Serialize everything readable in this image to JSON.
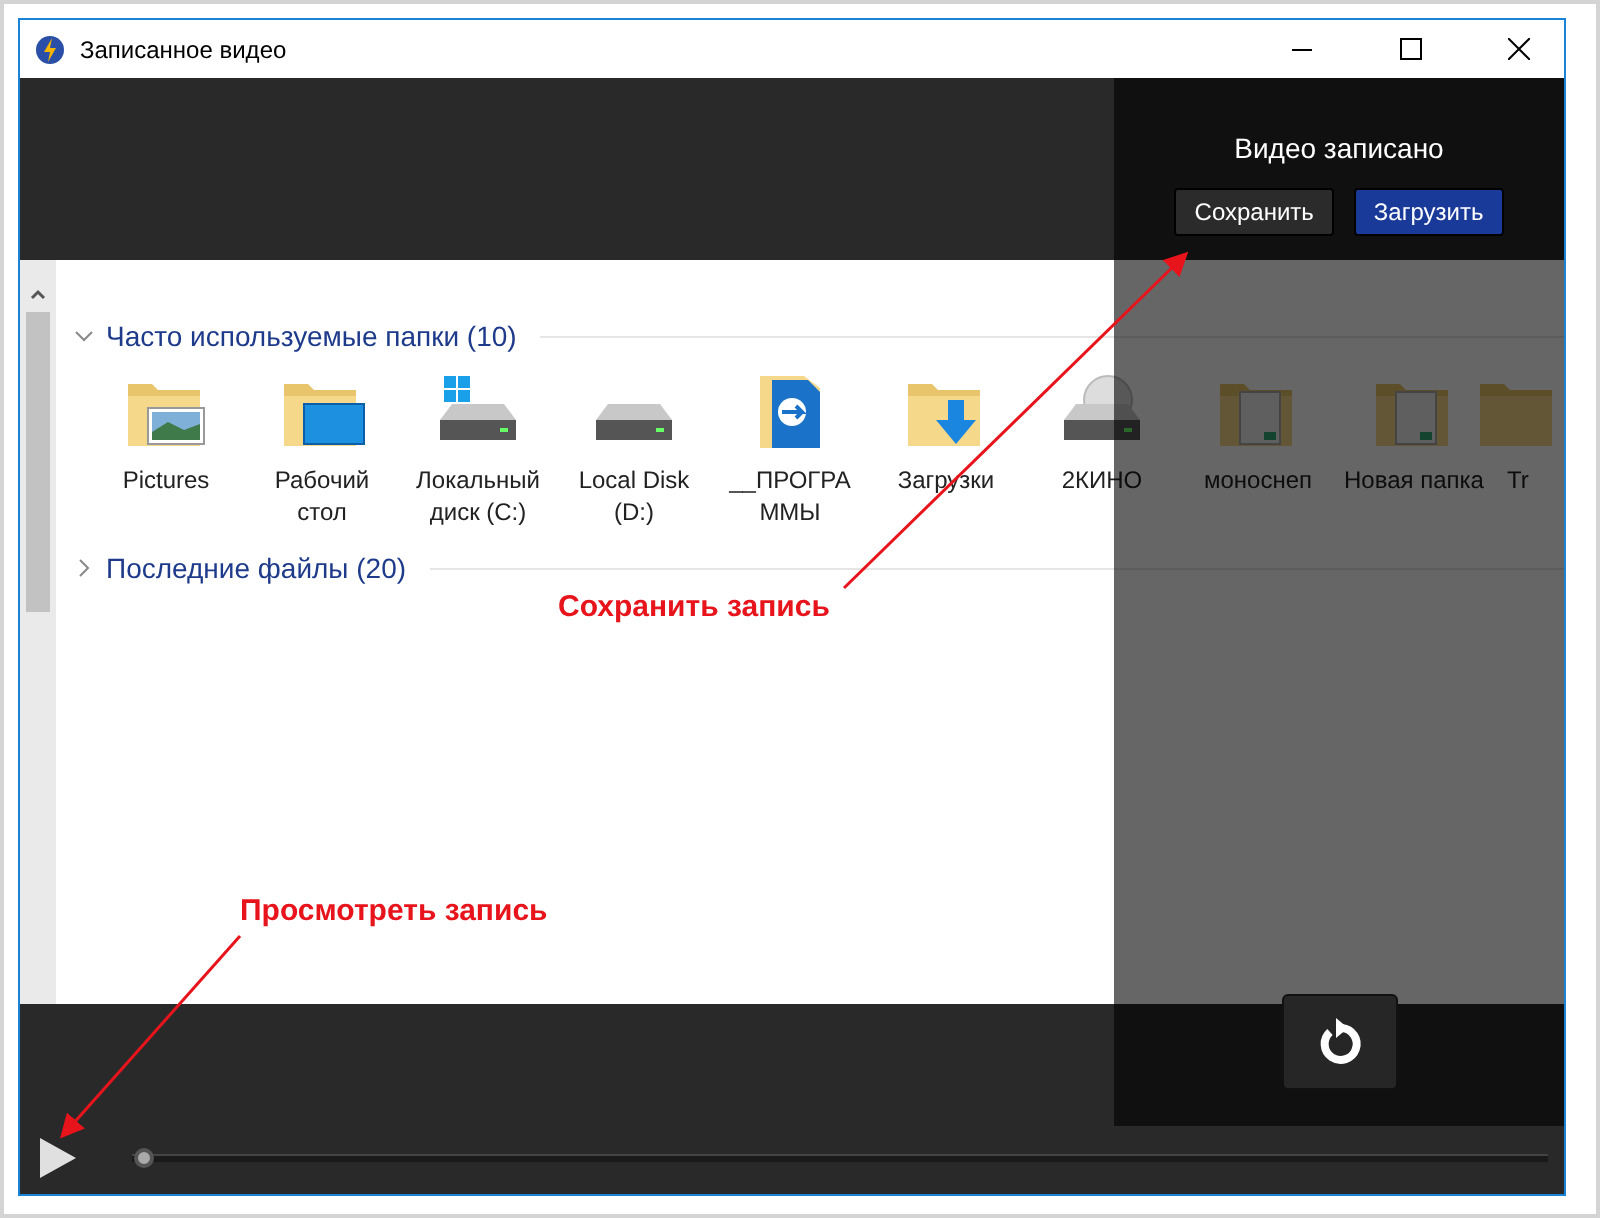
{
  "window": {
    "title": "Записанное видео"
  },
  "explorer": {
    "groups": [
      {
        "title": "Часто используемые папки (10)",
        "expanded": true,
        "items": [
          {
            "label": "Pictures",
            "kind": "pictures"
          },
          {
            "label": "Рабочий стол",
            "kind": "desktop"
          },
          {
            "label": "Локальный диск (C:)",
            "kind": "system"
          },
          {
            "label": "Local Disk (D:)",
            "kind": "drive"
          },
          {
            "label": "__ПРОГРАММЫ",
            "kind": "app"
          },
          {
            "label": "Загрузки",
            "kind": "downloads"
          },
          {
            "label": "2КИНО",
            "kind": "disc"
          },
          {
            "label": "моноснеп",
            "kind": "docs"
          },
          {
            "label": "Новая папка",
            "kind": "docs"
          },
          {
            "label": "Tr",
            "kind": "folder"
          }
        ]
      },
      {
        "title": "Последние файлы (20)",
        "expanded": false
      }
    ]
  },
  "panel": {
    "title": "Видео записано",
    "buttons": [
      {
        "label": "Сохранить",
        "kind": "secondary"
      },
      {
        "label": "Загрузить",
        "kind": "primary"
      }
    ]
  },
  "player": {
    "level": 0
  },
  "annotations": [
    {
      "text": "Сохранить запись"
    },
    {
      "text": "Просмотреть запись"
    }
  ]
}
